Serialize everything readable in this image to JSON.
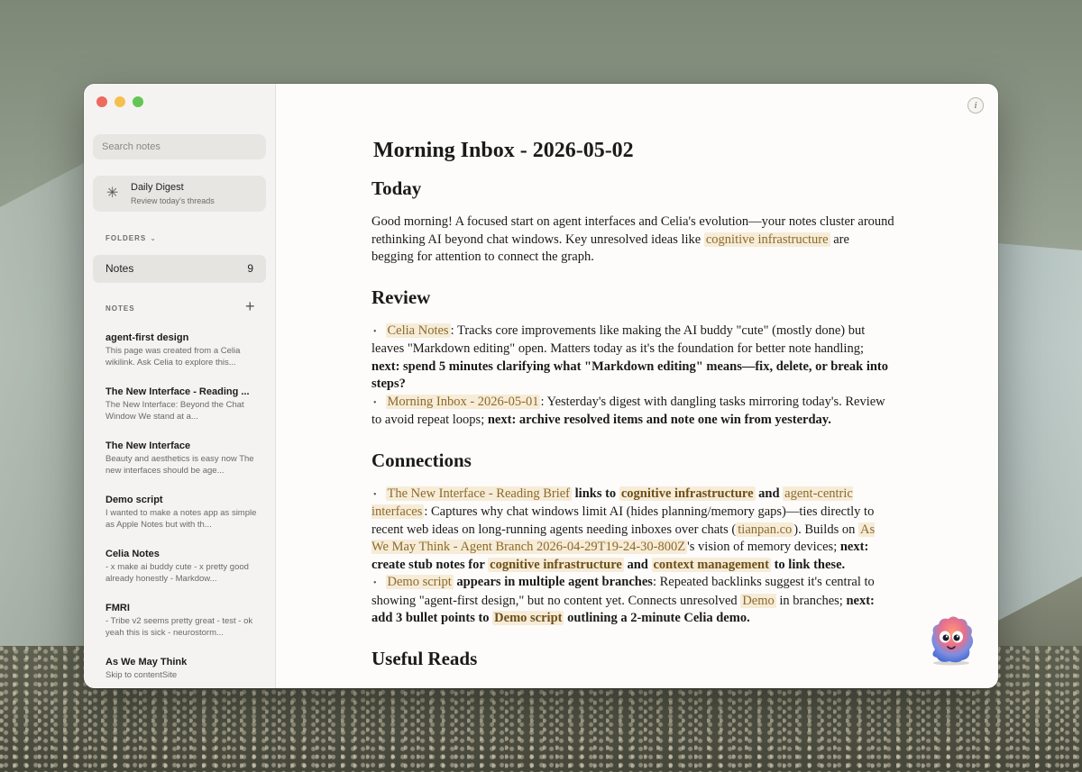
{
  "sidebar": {
    "search_placeholder": "Search notes",
    "digest": {
      "icon": "sparkle-icon",
      "title": "Daily Digest",
      "subtitle": "Review today's threads"
    },
    "folders_label": "FOLDERS",
    "folders": [
      {
        "name": "Notes",
        "count": "9"
      }
    ],
    "notes_label": "NOTES",
    "notes": [
      {
        "title": "agent-first design",
        "preview": "This page was created from a Celia wikilink. Ask Celia to explore this..."
      },
      {
        "title": "The New Interface - Reading ...",
        "preview": "The New Interface: Beyond the Chat Window We stand at a..."
      },
      {
        "title": "The New Interface",
        "preview": "Beauty and aesthetics is easy now The new interfaces should be age..."
      },
      {
        "title": "Demo script",
        "preview": "I wanted to make a notes app as simple as Apple Notes but with th..."
      },
      {
        "title": "Celia Notes",
        "preview": "- x make ai buddy cute - x pretty good already honestly - Markdow..."
      },
      {
        "title": "FMRI",
        "preview": "- Tribe v2 seems pretty great - test - ok yeah this is sick - neurostorm..."
      },
      {
        "title": "As We May Think",
        "preview": "Skip to contentSite"
      }
    ]
  },
  "doc": {
    "title": "Morning Inbox - 2026-05-02",
    "today_heading": "Today",
    "today": {
      "t1": "Good morning! A focused start on agent interfaces and Celia's evolution—your notes cluster around rethinking AI beyond chat windows. Key unresolved ideas like ",
      "l1": "cognitive infrastructure",
      "t2": " are begging for attention to connect the graph."
    },
    "review_heading": "Review",
    "review": [
      {
        "link": "Celia Notes",
        "text": ": Tracks core improvements like making the AI buddy \"cute\" (mostly done) but leaves \"Markdown editing\" open. Matters today as it's the foundation for better note handling; ",
        "bold": "next: spend 5 minutes clarifying what \"Markdown editing\" means—fix, delete, or break into steps?"
      },
      {
        "link": "Morning Inbox - 2026-05-01",
        "text": ": Yesterday's digest with dangling tasks mirroring today's. Review to avoid repeat loops; ",
        "bold": "next: archive resolved items and note one win from yesterday."
      }
    ],
    "connections_heading": "Connections",
    "connections": {
      "c1": {
        "l1": "The New Interface - Reading Brief",
        "b1": " links to ",
        "l2": "cognitive infrastructure",
        "b2": " and ",
        "l3": "agent-centric interfaces",
        "t1": ": Captures why chat windows limit AI (hides planning/memory gaps)—ties directly to recent web ideas on long-running agents needing inboxes over chats (",
        "l4": "tianpan.co",
        "t2": "). Builds on ",
        "l5": "As We May Think - Agent Branch 2026-04-29T19-24-30-800Z",
        "t3": "'s vision of memory devices; ",
        "b3": "next: create stub notes for ",
        "l6": "cognitive infrastructure",
        "b4": " and ",
        "l7": "context management",
        "b5": " to link these."
      },
      "c2": {
        "l1": "Demo script",
        "b1": " appears in multiple agent branches",
        "t1": ": Repeated backlinks suggest it's central to showing \"agent-first design,\" but no content yet. Connects unresolved ",
        "l2": "Demo",
        "t2": " in branches; ",
        "b2": "next: add 3 bullet points to ",
        "l3": "Demo script",
        "b3": " outlining a 2-minute Celia demo."
      }
    },
    "useful_heading": "Useful Reads"
  },
  "info_icon": "info-icon",
  "mascot_icon": "fuzzy-buddy-icon",
  "colors": {
    "accent_link_bg": "#f6ecd8",
    "link_text": "#8d6a2a",
    "sidebar_bg": "#f4f3f1"
  }
}
